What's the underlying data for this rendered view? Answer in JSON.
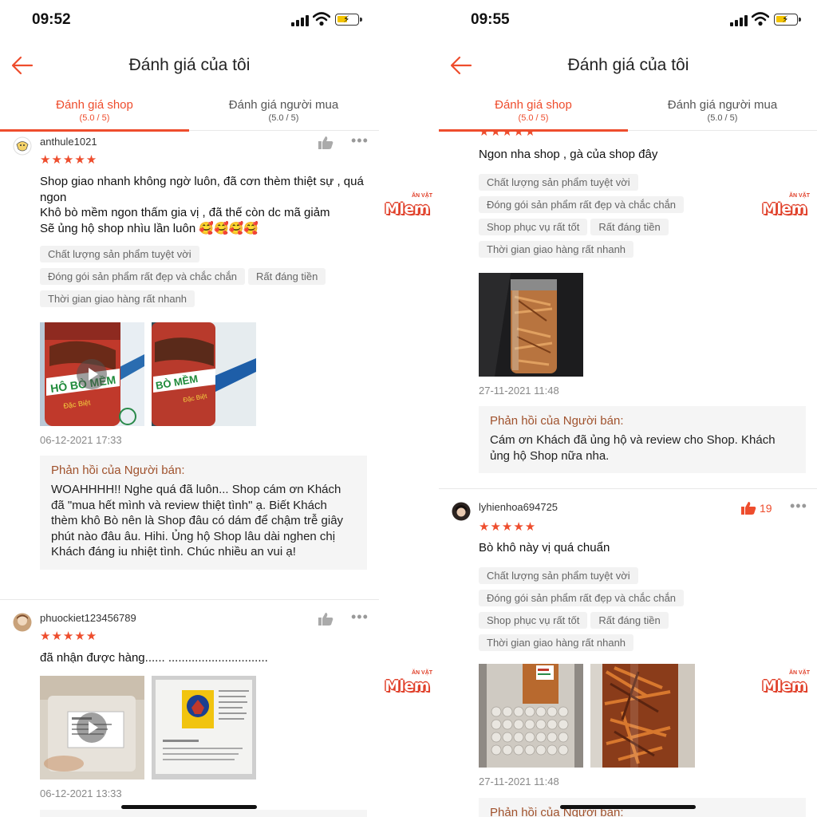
{
  "accent_color": "#ee4d2d",
  "watermark": {
    "text": "Mlem",
    "small": "ĂN VẶT"
  },
  "left": {
    "status": {
      "time": "09:52"
    },
    "nav": {
      "title": "Đánh giá của tôi",
      "back_icon": "arrow-left-icon"
    },
    "tabs": [
      {
        "label": "Đánh giá shop",
        "sub": "(5.0 / 5)"
      },
      {
        "label": "Đánh giá người mua",
        "sub": "(5.0 / 5)"
      }
    ],
    "reviews": [
      {
        "username": "anthule1021",
        "stars": "★★★★★",
        "text": "Shop giao nhanh không ngờ luôn, đã cơn thèm thiệt sự , quá ngon\nKhô bò mềm ngon thấm gia vị , đã thế còn dc mã giảm\nSẽ ủng hộ shop nhìu lần luôn 🥰🥰🥰🥰",
        "tags": [
          "Chất lượng sản phẩm tuyệt vời",
          "Đóng gói sản phẩm rất đẹp và chắc chắn",
          "Rất đáng tiền",
          "Thời gian giao hàng rất nhanh"
        ],
        "date": "06-12-2021 17:33",
        "reply_header": "Phản hồi của Người bán:",
        "reply_text": "WOAHHHH!! Nghe quá đã luôn... Shop cám ơn Khách đã \"mua hết mình và review thiệt tình\" ạ. Biết Khách thèm khô Bò nên là Shop đâu có dám để chậm trễ giây phút nào đâu âu. Hihi. Ủng hộ Shop lâu dài nghen chị Khách đáng iu nhiệt tình. Chúc nhiều an vui ạ!"
      },
      {
        "username": "phuockiet123456789",
        "stars": "★★★★★",
        "text": "đã nhận được hàng......   ..............................",
        "date": "06-12-2021 13:33"
      }
    ]
  },
  "right": {
    "status": {
      "time": "09:55"
    },
    "nav": {
      "title": "Đánh giá của tôi",
      "back_icon": "arrow-left-icon"
    },
    "tabs": [
      {
        "label": "Đánh giá shop",
        "sub": "(5.0 / 5)"
      },
      {
        "label": "Đánh giá người mua",
        "sub": "(5.0 / 5)"
      }
    ],
    "reviews": [
      {
        "stars": "★★★★★",
        "text": "Ngon nha shop , gà của shop đây",
        "tags": [
          "Chất lượng sản phẩm tuyệt vời",
          "Đóng gói sản phẩm rất đẹp và chắc chắn",
          "Shop phục vụ rất tốt",
          "Rất đáng tiền",
          "Thời gian giao hàng rất nhanh"
        ],
        "date": "27-11-2021 11:48",
        "reply_header": "Phản hồi của Người bán:",
        "reply_text": "Cám ơn Khách đã ủng hộ và review cho Shop. Khách ủng hộ Shop nữa nha."
      },
      {
        "username": "lyhienhoa694725",
        "likes": "19",
        "stars": "★★★★★",
        "text": "Bò khô này vị quá chuẩn",
        "tags": [
          "Chất lượng sản phẩm tuyệt vời",
          "Đóng gói sản phẩm rất đẹp và chắc chắn",
          "Shop phục vụ rất tốt",
          "Rất đáng tiền",
          "Thời gian giao hàng rất nhanh"
        ],
        "date": "27-11-2021 11:48",
        "reply_header": "Phản hồi của Người bán:"
      }
    ]
  }
}
